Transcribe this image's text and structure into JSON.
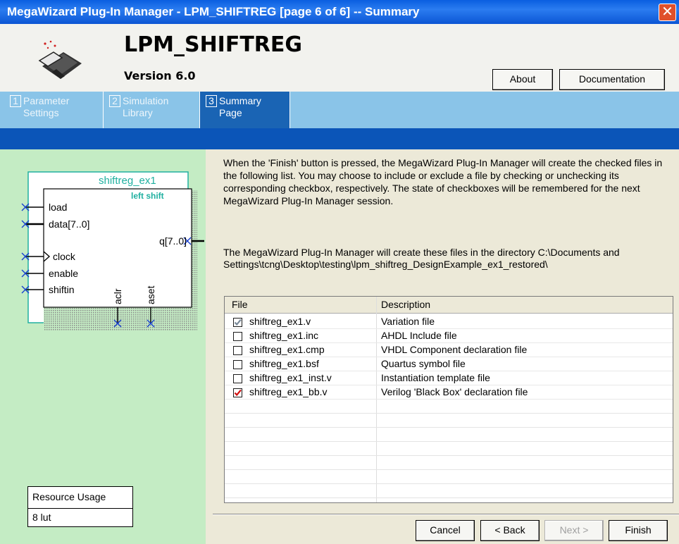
{
  "window": {
    "title": "MegaWizard Plug-In Manager - LPM_SHIFTREG [page 6 of 6] -- Summary",
    "close_glyph": "✕"
  },
  "header": {
    "title": "LPM_SHIFTREG",
    "version": "Version 6.0",
    "about_label": "About",
    "documentation_label": "Documentation"
  },
  "tabs": [
    {
      "num": "1",
      "label_line1": "Parameter",
      "label_line2": "Settings",
      "active": false
    },
    {
      "num": "2",
      "label_line1": "Simulation",
      "label_line2": "Library",
      "active": false
    },
    {
      "num": "3",
      "label_line1": "Summary",
      "label_line2": "Page",
      "active": true
    }
  ],
  "symbol": {
    "instance": "shiftreg_ex1",
    "mode": "left shift",
    "ports_left": [
      "load",
      "data[7..0]",
      "clock",
      "enable",
      "shiftin"
    ],
    "port_out": "q[7..0]",
    "ports_bottom": [
      "aclr",
      "aset"
    ]
  },
  "resource": {
    "header": "Resource Usage",
    "value": "8 lut"
  },
  "info": {
    "paragraph1": "When the 'Finish' button is pressed, the MegaWizard Plug-In Manager will create the checked files in the following list. You may choose to include or exclude a file by checking or unchecking its corresponding checkbox, respectively. The state of checkboxes will be remembered for the next MegaWizard Plug-In Manager session.",
    "paragraph2": "The MegaWizard Plug-In Manager will create these files in the directory C:\\Documents and Settings\\tcng\\Desktop\\testing\\lpm_shiftreg_DesignExample_ex1_restored\\"
  },
  "table": {
    "col_file": "File",
    "col_desc": "Description",
    "rows": [
      {
        "file": "shiftreg_ex1.v",
        "desc": "Variation file",
        "checked": true,
        "mark_color": "#7a8a9a"
      },
      {
        "file": "shiftreg_ex1.inc",
        "desc": "AHDL Include file",
        "checked": false
      },
      {
        "file": "shiftreg_ex1.cmp",
        "desc": "VHDL Component declaration file",
        "checked": false
      },
      {
        "file": "shiftreg_ex1.bsf",
        "desc": "Quartus symbol file",
        "checked": false
      },
      {
        "file": "shiftreg_ex1_inst.v",
        "desc": "Instantiation template file",
        "checked": false
      },
      {
        "file": "shiftreg_ex1_bb.v",
        "desc": "Verilog 'Black Box' declaration file",
        "checked": true,
        "mark_color": "#d01010"
      }
    ]
  },
  "buttons": {
    "cancel": "Cancel",
    "back": "< Back",
    "next": "Next >",
    "finish": "Finish"
  },
  "colors": {
    "title_bar": "#0a5fe0",
    "tab_bar": "#8ac4e8",
    "tab_active": "#1a64b4",
    "left_pane": "#c4ecc4",
    "symbol_teal": "#20b0a0",
    "pin_blue": "#1840d0"
  }
}
